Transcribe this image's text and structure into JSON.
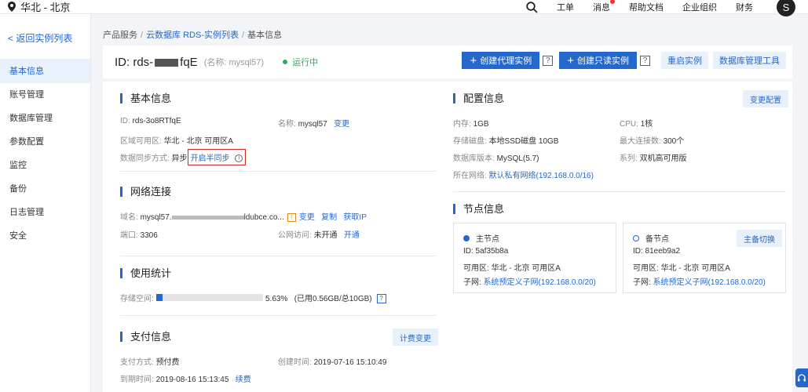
{
  "topbar": {
    "region": "华北 - 北京",
    "links": [
      "工单",
      "消息",
      "帮助文档",
      "企业组织",
      "财务"
    ],
    "avatar": "S"
  },
  "sidebar": {
    "back": "< 返回实例列表",
    "items": [
      "基本信息",
      "账号管理",
      "数据库管理",
      "参数配置",
      "监控",
      "备份",
      "日志管理",
      "安全"
    ],
    "active": "基本信息"
  },
  "breadcrumb": [
    "产品服务",
    "云数据库 RDS-实例列表",
    "基本信息"
  ],
  "header": {
    "id_prefix": "ID: rds-",
    "id_suffix": "fqE",
    "name": "(名称: mysql57)",
    "status": "运行中",
    "btn_proxy": "创建代理实例",
    "btn_readonly": "创建只读实例",
    "btn_restart": "重启实例",
    "btn_dbtool": "数据库管理工具",
    "help": "?"
  },
  "basic": {
    "title": "基本信息",
    "id_label": "ID:",
    "id_value": "rds-3o8RTfqE",
    "name_label": "名称:",
    "name_value": "mysql57",
    "name_action": "变更",
    "zone_label": "区域可用区:",
    "zone_value": "华北 - 北京 可用区A",
    "sync_label": "数据同步方式:",
    "sync_value": "异步",
    "sync_action": "开启半同步"
  },
  "network": {
    "title": "网络连接",
    "domain_label": "域名:",
    "domain_prefix": "mysql57.",
    "domain_suffix": "ldubce.co...",
    "warn": "!",
    "action_change": "变更",
    "action_copy": "复制",
    "action_getip": "获取IP",
    "port_label": "端口:",
    "port_value": "3306",
    "public_label": "公网访问:",
    "public_value": "未开通",
    "public_action": "开通"
  },
  "usage": {
    "title": "使用统计",
    "storage_label": "存储空间:",
    "percent": "5.63%",
    "used_fraction": 0.0563,
    "detail": "(已用0.56GB/总10GB)",
    "help": "?"
  },
  "payment": {
    "title": "支付信息",
    "change_btn": "计费变更",
    "method_label": "支付方式:",
    "method_value": "预付费",
    "created_label": "创建时间:",
    "created_value": "2019-07-16 15:10:49",
    "expire_label": "到期时间:",
    "expire_value": "2019-08-16 15:13:45",
    "renew": "续费"
  },
  "config": {
    "title": "配置信息",
    "change_btn": "变更配置",
    "mem_label": "内存:",
    "mem_value": "1GB",
    "cpu_label": "CPU:",
    "cpu_value": "1核",
    "disk_label": "存储磁盘:",
    "disk_value": "本地SSD磁盘 10GB",
    "maxconn_label": "最大连接数:",
    "maxconn_value": "300个",
    "dbver_label": "数据库版本:",
    "dbver_value": "MySQL(5.7)",
    "series_label": "系列:",
    "series_value": "双机高可用版",
    "net_label": "所在网络:",
    "net_value": "默认私有网络(192.168.0.0/16)"
  },
  "nodes": {
    "title": "节点信息",
    "master": {
      "title": "主节点",
      "id": "ID: 5af35b8a",
      "zone_label": "可用区:",
      "zone_value": "华北 - 北京 可用区A",
      "subnet_label": "子网:",
      "subnet_value": "系统预定义子网(192.168.0.0/20)"
    },
    "standby": {
      "title": "备节点",
      "switch_btn": "主备切换",
      "id": "ID: 81eeb9a2",
      "zone_label": "可用区:",
      "zone_value": "华北 - 北京 可用区A",
      "subnet_label": "子网:",
      "subnet_value": "系统预定义子网(192.168.0.0/20)"
    }
  }
}
